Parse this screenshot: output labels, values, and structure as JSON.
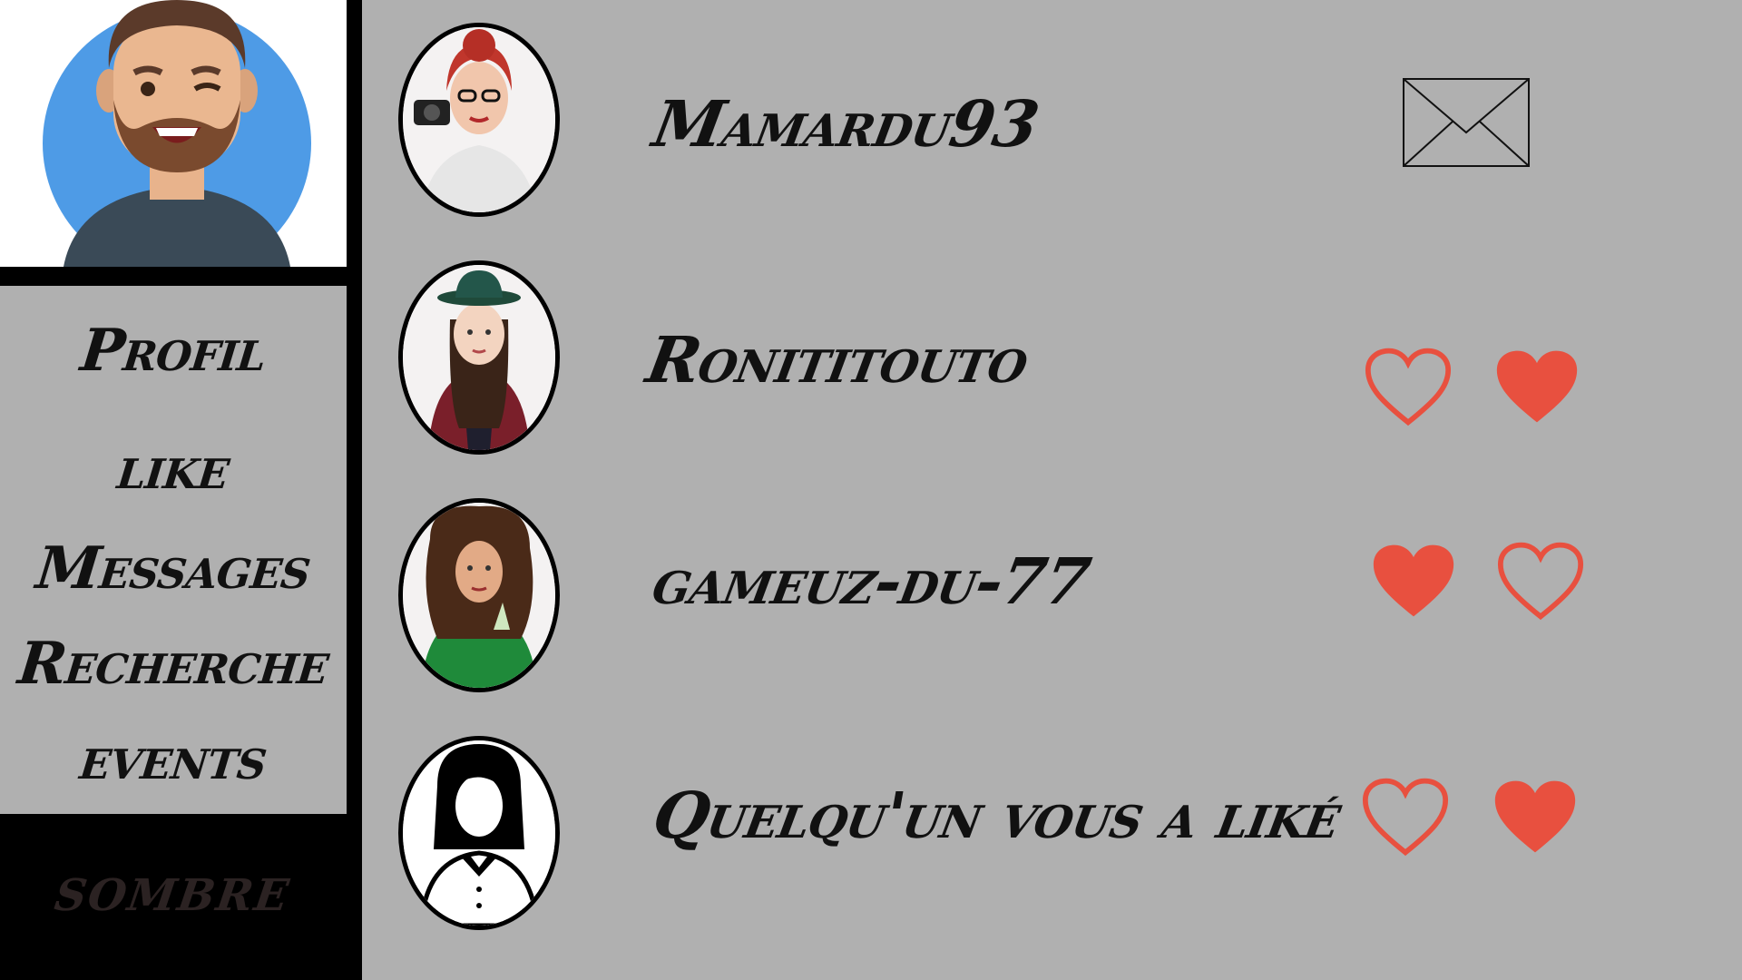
{
  "sidebar": {
    "nav": {
      "profil": "Profil",
      "like": "like",
      "messages": "Messages",
      "recherche": "Recherche",
      "events": "events"
    },
    "theme_label": "sombre"
  },
  "rows": [
    {
      "name": "Mamardu93",
      "action": "envelope-icon"
    },
    {
      "name": "Ronititouto",
      "actions": [
        "heart-outline-icon",
        "heart-filled-icon"
      ]
    },
    {
      "name": "gameuz-du-77",
      "actions": [
        "heart-filled-icon",
        "heart-outline-icon"
      ]
    },
    {
      "name": "Quelqu'un vous a liké",
      "actions": [
        "heart-outline-icon",
        "heart-filled-icon"
      ]
    }
  ],
  "colors": {
    "background": "#b0b0b0",
    "heart": "#e8503f",
    "avatar_circle": "#4e9be6",
    "sidebar_dark": "#000000"
  }
}
